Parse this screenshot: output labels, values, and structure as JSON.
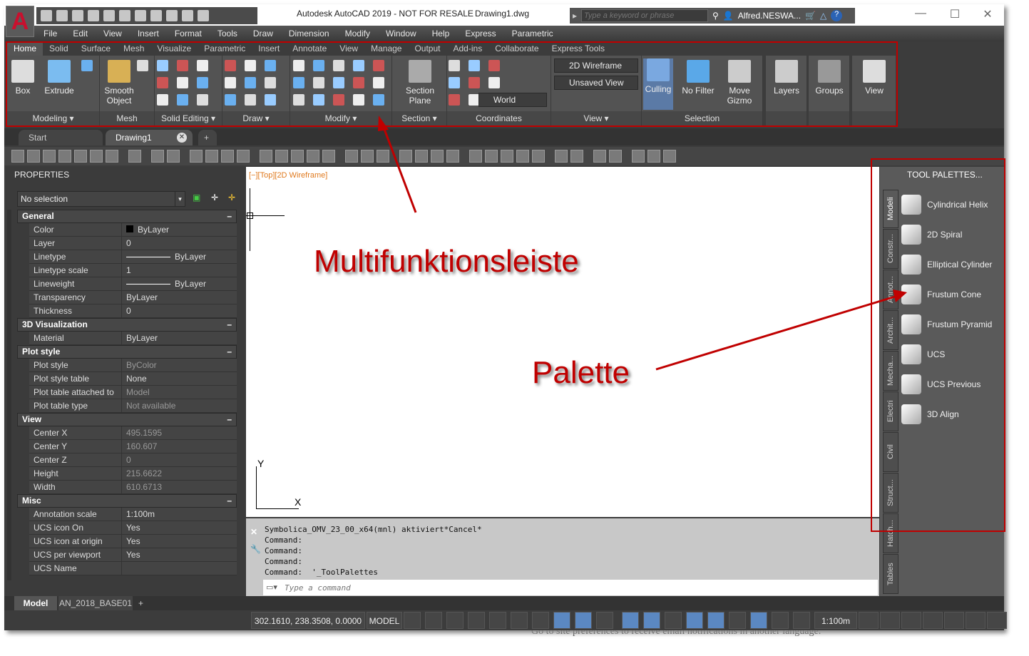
{
  "app": {
    "title": "Autodesk AutoCAD 2019 - NOT FOR RESALE",
    "drawing": "Drawing1.dwg",
    "logo": "A",
    "search_placeholder": "Type a keyword or phrase",
    "user": "Alfred.NESWA..."
  },
  "menu": [
    "File",
    "Edit",
    "View",
    "Insert",
    "Format",
    "Tools",
    "Draw",
    "Dimension",
    "Modify",
    "Window",
    "Help",
    "Express",
    "Parametric"
  ],
  "ribbon_tabs": [
    "Home",
    "Solid",
    "Surface",
    "Mesh",
    "Visualize",
    "Parametric",
    "Insert",
    "Annotate",
    "View",
    "Manage",
    "Output",
    "Add-ins",
    "Collaborate",
    "Express Tools"
  ],
  "ribbon": {
    "panels": [
      "Modeling ▾",
      "Mesh",
      "Solid Editing ▾",
      "Draw ▾",
      "Modify ▾",
      "Section ▾",
      "Coordinates",
      "View ▾",
      "Selection",
      "",
      "",
      ""
    ],
    "buttons": {
      "box": "Box",
      "extrude": "Extrude",
      "smooth": "Smooth Object",
      "section": "Section Plane",
      "culling": "Culling",
      "nofilter": "No Filter",
      "gizmo": "Move Gizmo",
      "layers": "Layers",
      "groups": "Groups",
      "view": "View"
    },
    "combos": {
      "visual_style": "2D Wireframe",
      "view": "Unsaved View",
      "ucs": "World"
    }
  },
  "file_tabs": {
    "start": "Start",
    "drawing": "Drawing1"
  },
  "properties": {
    "title": "PROPERTIES",
    "selection": "No selection",
    "sections": [
      {
        "name": "General",
        "rows": [
          [
            "Color",
            "ByLayer"
          ],
          [
            "Layer",
            "0"
          ],
          [
            "Linetype",
            "ByLayer"
          ],
          [
            "Linetype scale",
            "1"
          ],
          [
            "Lineweight",
            "ByLayer"
          ],
          [
            "Transparency",
            "ByLayer"
          ],
          [
            "Thickness",
            "0"
          ]
        ]
      },
      {
        "name": "3D Visualization",
        "rows": [
          [
            "Material",
            "ByLayer"
          ]
        ]
      },
      {
        "name": "Plot style",
        "rows": [
          [
            "Plot style",
            "ByColor"
          ],
          [
            "Plot style table",
            "None"
          ],
          [
            "Plot table attached to",
            "Model"
          ],
          [
            "Plot table type",
            "Not available"
          ]
        ]
      },
      {
        "name": "View",
        "rows": [
          [
            "Center X",
            "495.1595"
          ],
          [
            "Center Y",
            "160.607"
          ],
          [
            "Center Z",
            "0"
          ],
          [
            "Height",
            "215.6622"
          ],
          [
            "Width",
            "610.6713"
          ]
        ]
      },
      {
        "name": "Misc",
        "rows": [
          [
            "Annotation scale",
            "1:100m"
          ],
          [
            "UCS icon On",
            "Yes"
          ],
          [
            "UCS icon at origin",
            "Yes"
          ],
          [
            "UCS per viewport",
            "Yes"
          ],
          [
            "UCS Name",
            ""
          ]
        ]
      }
    ]
  },
  "viewport": {
    "controls": "[−][Top][2D Wireframe]",
    "axis_x": "X",
    "axis_y": "Y"
  },
  "command": {
    "history": [
      "Symbolica_OMV_23_00_x64(mnl) aktiviert*Cancel*",
      "Command:",
      "Command:",
      "Command:",
      "Command:  '_ToolPalettes"
    ],
    "placeholder": "Type a command"
  },
  "tool_palette": {
    "title": "TOOL PALETTES...",
    "items": [
      "Cylindrical Helix",
      "2D Spiral",
      "Elliptical Cylinder",
      "Frustum Cone",
      "Frustum Pyramid",
      "UCS",
      "UCS Previous",
      "3D Align"
    ],
    "tabs": [
      "Modeli",
      "Constr...",
      "Annot...",
      "Archit...",
      "Mecha...",
      "Electri",
      "Civil",
      "Struct...",
      "Hatch...",
      "Tables"
    ]
  },
  "layout_tabs": [
    "Model",
    "AN_2018_BASE01"
  ],
  "status": {
    "coords": "302.1610, 238.3508, 0.0000",
    "space": "MODEL",
    "scale": "1:100m"
  },
  "annotations": {
    "ribbon_label": "Multifunktionsleiste",
    "palette_label": "Palette",
    "color": "#c00000"
  },
  "background_text": "Go to site preferences to receive email notifications in another language."
}
